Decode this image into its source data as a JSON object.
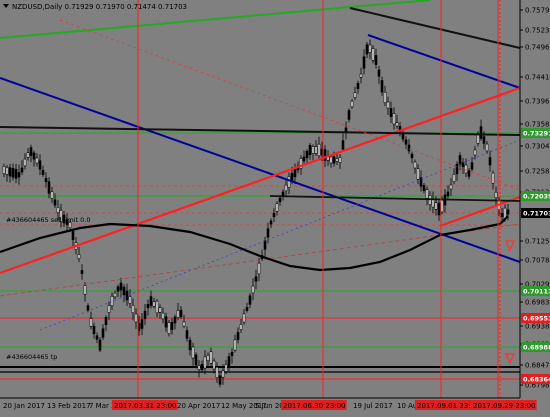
{
  "header": {
    "symbol_line": "NZDUSD,Daily  0.71929 0.71970 0.71474 0.71703",
    "menu_icon": "dropdown-triangle-icon"
  },
  "price_scale": [
    {
      "label": "0.75790"
    },
    {
      "label": "0.75235"
    },
    {
      "label": "0.74965"
    },
    {
      "label": "0.74410"
    },
    {
      "label": "0.73960"
    },
    {
      "label": "0.73585"
    },
    {
      "label": "0.73045"
    },
    {
      "label": "0.72580"
    },
    {
      "label": "0.72130"
    },
    {
      "label": "0.71255"
    },
    {
      "label": "0.70780"
    },
    {
      "label": "0.70290"
    },
    {
      "label": "0.69830"
    },
    {
      "label": "0.69380"
    },
    {
      "label": "0.68920"
    },
    {
      "label": "0.68470"
    },
    {
      "label": "0.67980"
    }
  ],
  "price_tags": [
    {
      "text": "0.73291",
      "bg": "#2e9a2e",
      "fg": "#ffffff"
    },
    {
      "text": "0.72039",
      "bg": "#2e9a2e",
      "fg": "#ffffff"
    },
    {
      "text": "0.71703",
      "bg": "#000000",
      "fg": "#ffffff"
    },
    {
      "text": "0.70113",
      "bg": "#2e9a2e",
      "fg": "#ffffff"
    },
    {
      "text": "0.69553",
      "bg": "#e02020",
      "fg": "#ffffff"
    },
    {
      "text": "0.68988",
      "bg": "#2e9a2e",
      "fg": "#ffffff"
    },
    {
      "text": "0.68364",
      "bg": "#e02020",
      "fg": "#ffffff"
    }
  ],
  "time_scale": [
    {
      "label": "20 Jan 2017"
    },
    {
      "label": "13 Feb 2017"
    },
    {
      "label": "7 Mar 2"
    },
    {
      "label": "2017.03.31 23:00"
    },
    {
      "label": "20 Apr 2017"
    },
    {
      "label": "12 May 2017"
    },
    {
      "label": "5 Jun 20"
    },
    {
      "label": "2017.06.30 23:00"
    },
    {
      "label": "19 Jul 2017"
    },
    {
      "label": "10 Au"
    },
    {
      "label": "2017.09.01 23:00"
    },
    {
      "label": "2017.09.29 23:00"
    }
  ],
  "notes": {
    "order_label_1": "#436604465 sell limit 0.0",
    "order_label_2": "#436604465 tp"
  },
  "colors": {
    "chart_bg": "#808080",
    "candle": "#000000",
    "green_line": "#22aa22",
    "red_line": "#ff2020",
    "blue_line": "#000099",
    "black_line": "#111111"
  }
}
